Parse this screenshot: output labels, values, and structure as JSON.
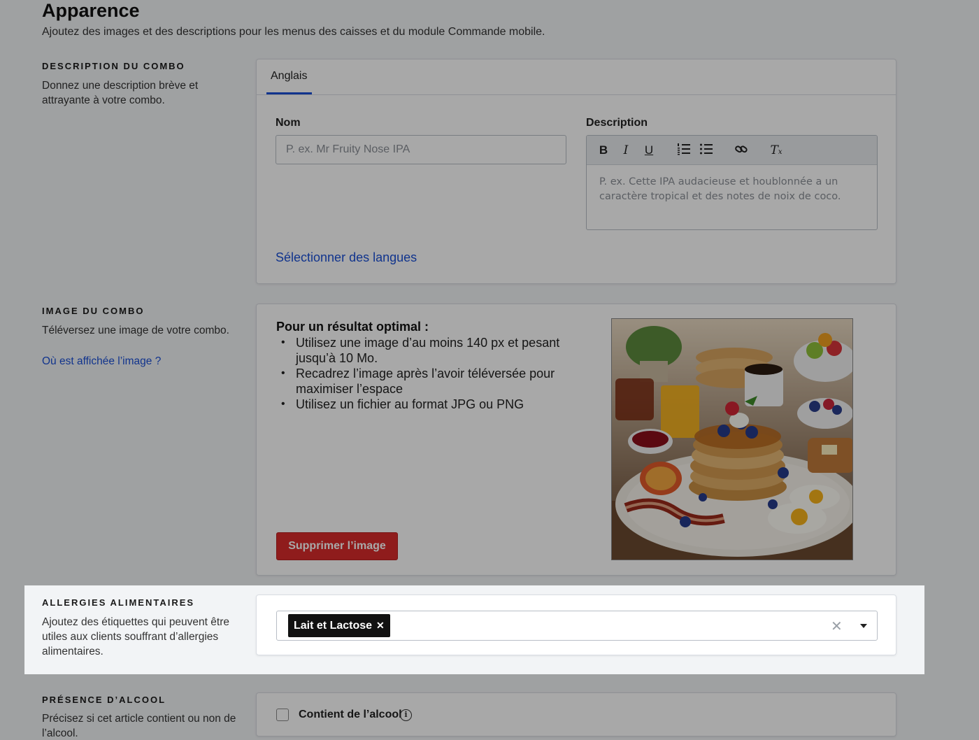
{
  "header": {
    "title": "Apparence",
    "subtitle": "Ajoutez des images et des descriptions pour les menus des caisses et du module Commande mobile."
  },
  "description_section": {
    "label": "DESCRIPTION DU COMBO",
    "desc": "Donnez une description brève et attrayante à votre combo.",
    "tab": "Anglais",
    "name_label": "Nom",
    "name_placeholder": "P. ex. Mr Fruity Nose IPA",
    "description_label": "Description",
    "description_placeholder": "P. ex. Cette IPA audacieuse et houblonnée a un caractère tropical et des notes de noix de coco.",
    "toolbar_icons": [
      "bold-icon",
      "italic-icon",
      "underline-icon",
      "ordered-list-icon",
      "bullet-list-icon",
      "link-icon",
      "clear-format-icon"
    ],
    "select_languages_link": "Sélectionner des langues"
  },
  "image_section": {
    "label": "IMAGE DU COMBO",
    "desc": "Téléversez une image de votre combo.",
    "where_link": "Où est affichée l’image ?",
    "tips_title": "Pour un résultat optimal :",
    "tips": [
      "Utilisez une image d’au moins 140 px et pesant jusqu’à 10 Mo.",
      "Recadrez l’image après l’avoir téléversée pour maximiser l’espace",
      "Utilisez un fichier au format JPG ou PNG"
    ],
    "delete_button": "Supprimer l’image"
  },
  "allergies_section": {
    "label": "ALLERGIES ALIMENTAIRES",
    "desc": "Ajoutez des étiquettes qui peuvent être utiles aux clients souffrant d’allergies alimentaires.",
    "selected_tags": [
      "Lait et Lactose"
    ]
  },
  "alcohol_section": {
    "label": "PRÉSENCE D’ALCOOL",
    "desc": "Précisez si cet article contient ou non de l’alcool.",
    "checkbox_label": "Contient de l’alcool",
    "checked": false
  },
  "colors": {
    "accent": "#1a4fd6",
    "danger": "#d92b2b",
    "tag": "#111111"
  }
}
